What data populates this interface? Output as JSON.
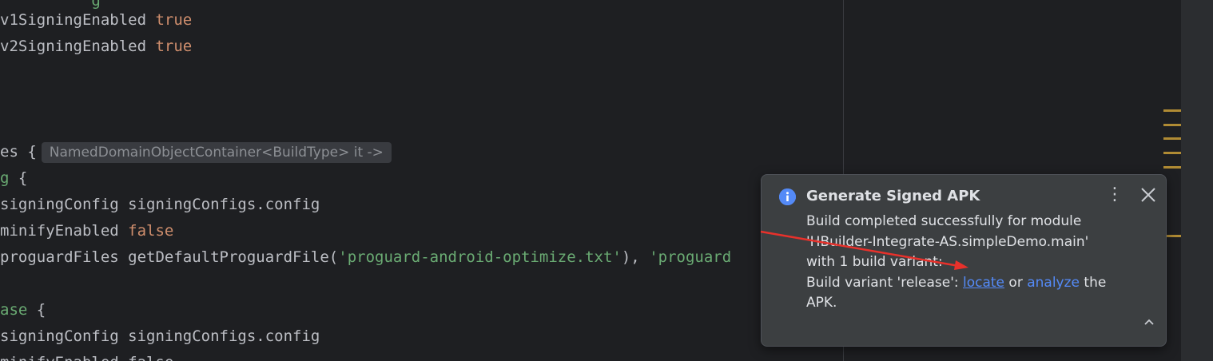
{
  "code": {
    "l0": {
      "a": "v1SigningEnabled ",
      "b": "true"
    },
    "l1": {
      "a": "v2SigningEnabled ",
      "b": "true"
    },
    "l2": {
      "a": "es ",
      "b": "{",
      "hint": "NamedDomainObjectContainer<BuildType> it ->"
    },
    "l3": {
      "a": "g",
      "b": " {"
    },
    "l4": {
      "a": "signingConfig signingConfigs.config"
    },
    "l5": {
      "a": "minifyEnabled ",
      "b": "false"
    },
    "l6": {
      "a": "proguardFiles getDefaultProguardFile(",
      "s1": "'proguard-android-optimize.txt'",
      "c": "), ",
      "s2": "'proguard"
    },
    "l7": {
      "a": "ase",
      "b": " {"
    },
    "l8": {
      "a": "signingConfig signingConfigs.config"
    },
    "l9": {
      "a": "minifyEnabled false"
    }
  },
  "notification": {
    "icon": "info-icon",
    "title": "Generate Signed APK",
    "line1": "Build completed successfully for module",
    "line2": "'HBuilder-Integrate-AS.simpleDemo.main'",
    "line3": "with 1 build variant:",
    "line4_prefix": "Build variant 'release': ",
    "locate_link": "locate",
    "or_text": " or ",
    "analyze_link": "analyze",
    "line4_suffix": " the",
    "line5": "APK."
  },
  "colors": {
    "keyword": "#cf8e6d",
    "string": "#6aab73",
    "link": "#548af7",
    "annotation_arrow": "#e8312b"
  }
}
